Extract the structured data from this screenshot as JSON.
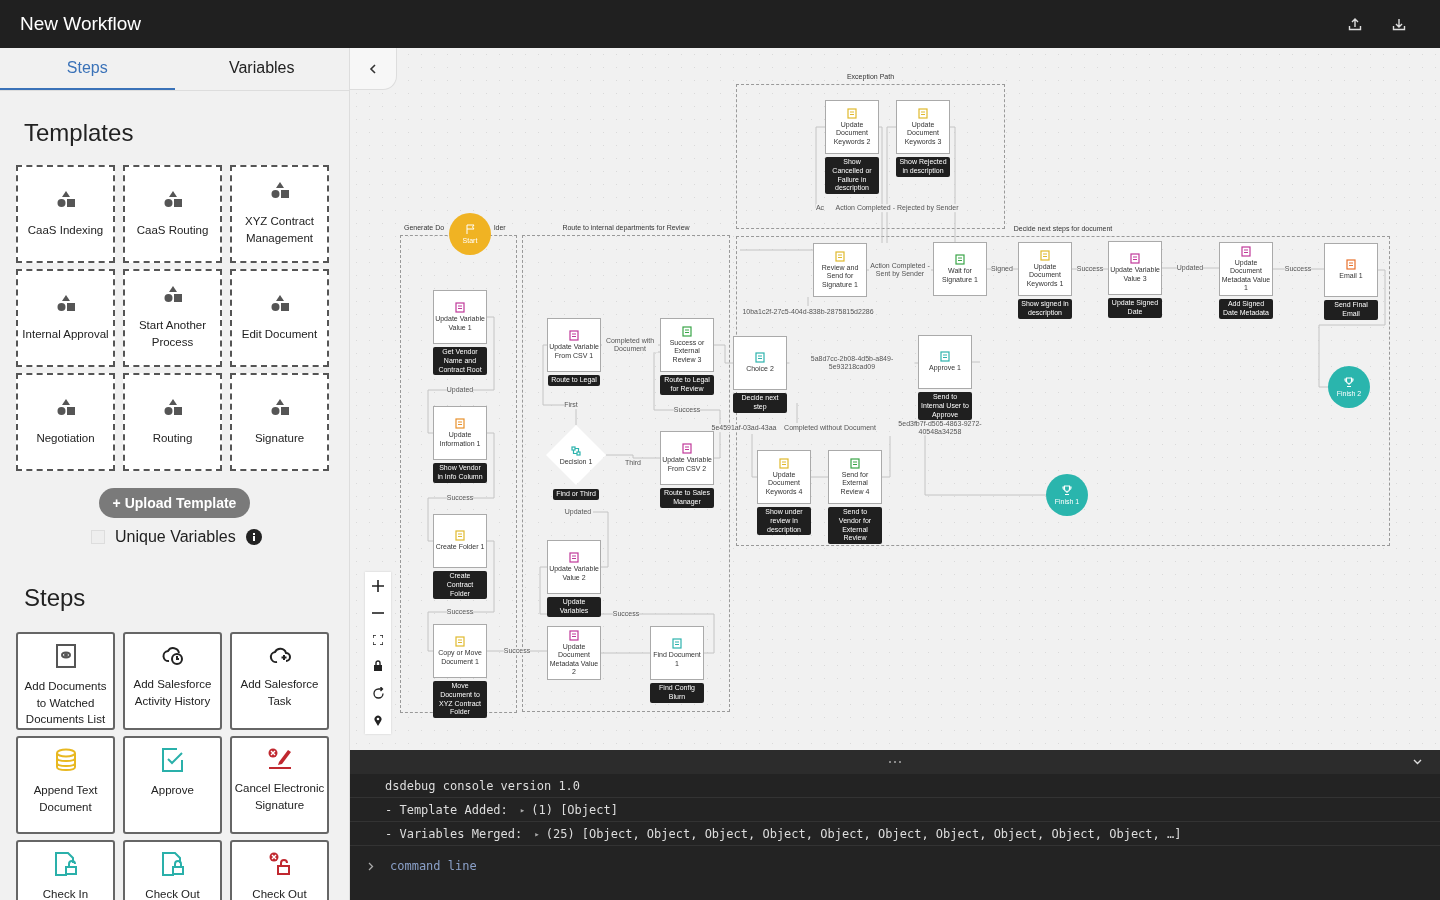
{
  "header": {
    "title": "New Workflow"
  },
  "sidebar": {
    "tabs": [
      {
        "label": "Steps",
        "selected": true
      },
      {
        "label": "Variables",
        "selected": false
      }
    ],
    "templates_heading": "Templates",
    "templates": [
      "CaaS Indexing",
      "CaaS Routing",
      "XYZ Contract Management",
      "Internal Approval",
      "Start Another Process",
      "Edit Document",
      "Negotiation",
      "Routing",
      "Signature"
    ],
    "upload_button": "+ Upload Template",
    "unique_variables": {
      "label": "Unique Variables",
      "checked": false
    },
    "steps_heading": "Steps",
    "steps": [
      "Add Documents to Watched Documents List",
      "Add Salesforce Activity History",
      "Add Salesforce Task",
      "Append Text Document",
      "Approve",
      "Cancel Electronic Signature",
      "Check In",
      "Check Out",
      "Check Out"
    ]
  },
  "canvas": {
    "groups": [
      {
        "title": "Generate Do",
        "title_tail": "lder"
      },
      {
        "title": "Route to internal departments for Review"
      },
      {
        "title": "Exception Path"
      },
      {
        "title": "Decide next steps for document"
      }
    ],
    "nodes": [
      {
        "kind": "start",
        "label": "Start"
      },
      {
        "kind": "step",
        "label": "Update Variable Value 1",
        "caption": "Get Vendor Name and Contract Root"
      },
      {
        "kind": "step",
        "label": "Update Information 1",
        "caption": "Show Vendor in Info Column"
      },
      {
        "kind": "step",
        "label": "Create Folder 1",
        "caption": "Create Contract Folder"
      },
      {
        "kind": "step",
        "label": "Copy or Move Document 1",
        "caption": "Move Document to XYZ Contract Folder"
      },
      {
        "kind": "step",
        "label": "Update Variable From CSV 1",
        "caption": "Route to Legal"
      },
      {
        "kind": "step",
        "label": "Success or External Review 3",
        "caption": "Route to Legal for Review"
      },
      {
        "kind": "decision",
        "label": "Decision 1",
        "caption": "Find or Third"
      },
      {
        "kind": "step",
        "label": "Update Variable From CSV 2",
        "caption": "Route to Sales Manager"
      },
      {
        "kind": "step",
        "label": "Update Variable Value 2",
        "caption": "Update Variables"
      },
      {
        "kind": "step",
        "label": "Update Document Metadata Value 2"
      },
      {
        "kind": "step",
        "label": "Find Document 1",
        "caption": "Find Config Blurn"
      },
      {
        "kind": "step",
        "label": "Update Document Keywords 2",
        "caption": "Show Cancelled or Failure in description"
      },
      {
        "kind": "step",
        "label": "Update Document Keywords 3",
        "caption": "Show Rejected in description"
      },
      {
        "kind": "step",
        "label": "Review and Send for Signature 1"
      },
      {
        "kind": "step",
        "label": "Wait for Signature 1"
      },
      {
        "kind": "step",
        "label": "Update Document Keywords 1",
        "caption": "Show signed in description"
      },
      {
        "kind": "step",
        "label": "Update Variable Value 3",
        "caption": "Update Signed Date"
      },
      {
        "kind": "step",
        "label": "Update Document Metadata Value 1",
        "caption": "Add Signed Date Metadata"
      },
      {
        "kind": "step",
        "label": "Email 1",
        "caption": "Send Final Email"
      },
      {
        "kind": "step",
        "label": "Choice 2",
        "caption": "Decide next step"
      },
      {
        "kind": "step",
        "label": "Approve 1",
        "caption": "Send to Internal User to Approve"
      },
      {
        "kind": "step",
        "label": "Update Document Keywords 4",
        "caption": "Show under review in description"
      },
      {
        "kind": "step",
        "label": "Send for External Review 4",
        "caption": "Send to Vendor for External Review"
      },
      {
        "kind": "finish",
        "label": "Finish 2"
      },
      {
        "kind": "finish",
        "label": "Finish 1"
      }
    ],
    "edge_labels": [
      "Updated",
      "Success",
      "Success",
      "Success",
      "Completed with Document",
      "First",
      "Third",
      "Updated",
      "Success",
      "Success",
      "Ac",
      "Action Completed - Rejected by Sender",
      "Action Completed - Sent by Sender",
      "Signed",
      "Success",
      "Updated",
      "Success",
      "10ba1c2f-27c5-404d-838b-2875815d2286",
      "5a8d7cc-2b08-4d5b-a849-5e93218cad09",
      "5e4591af-03ad-43aa",
      "Completed without Document",
      "5ed3fb7f-d505-4863-9272-40548a34258"
    ]
  },
  "console": {
    "lines": [
      {
        "text": "dsdebug console version 1.0"
      },
      {
        "text": "- Template Added:",
        "toggle": "▸",
        "value": "(1) [Object]"
      },
      {
        "text": "- Variables Merged:",
        "toggle": "▸",
        "value": "(25) [Object, Object, Object, Object, Object, Object, Object, Object, Object, Object, …]"
      }
    ],
    "command": {
      "placeholder": "command line"
    }
  }
}
